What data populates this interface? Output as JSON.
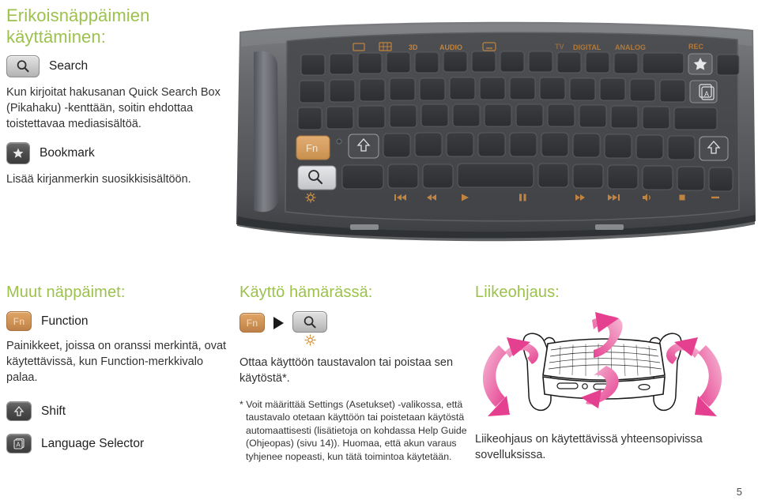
{
  "top_left": {
    "heading": "Erikoisnäppäimien käyttäminen:",
    "search_key_label": "Search",
    "search_desc": "Kun kirjoitat hakusanan Quick Search Box (Pikahaku) -kenttään, soitin ehdottaa toistettavaa mediasisältöä.",
    "bookmark_key_label": "Bookmark",
    "bookmark_desc": "Lisää kirjanmerkin suosikkisisältöön."
  },
  "keyboard": {
    "top_labels_left": [
      "[I+]",
      "grid",
      "3D",
      "AUDIO",
      "subtitle"
    ],
    "top_labels_right": [
      "TV",
      "DIGITAL",
      "ANALOG",
      "REC"
    ],
    "fn_key": "Fn",
    "media_icons": [
      "brightness",
      "prev-track",
      "rewind",
      "play",
      "pause",
      "fast-forward",
      "next-track",
      "volume",
      "stop",
      "mute"
    ]
  },
  "col_other_keys": {
    "heading": "Muut näppäimet:",
    "function_key": "Fn",
    "function_label": "Function",
    "function_desc": "Painikkeet, joissa on oranssi merkintä, ovat käytettävissä, kun Function-merkkivalo palaa.",
    "shift_label": "Shift",
    "language_label": "Language Selector"
  },
  "col_dark": {
    "heading": "Käyttö hämärässä:",
    "fn_key": "Fn",
    "desc": "Ottaa käyttöön taustavalon tai poistaa sen käytöstä*.",
    "footnote": "* Voit määrittää Settings (Asetukset) -valikossa, että taustavalo otetaan käyttöön tai poistetaan käytöstä automaattisesti (lisätietoja on kohdassa Help Guide (Ohjeopas) (sivu 14)). Huomaa, että akun varaus tyhjenee nopeasti, kun tätä toimintoa käytetään."
  },
  "col_motion": {
    "heading": "Liikeohjaus:",
    "desc": "Liikeohjaus on käytettävissä yhteensopivissa sovelluksissa."
  },
  "page_number": "5",
  "colors": {
    "heading_green": "#9cc24d",
    "accent_orange": "#d08a28",
    "arrow_pink": "#e8418f",
    "arrow_pink_light": "#f2a7c8"
  }
}
